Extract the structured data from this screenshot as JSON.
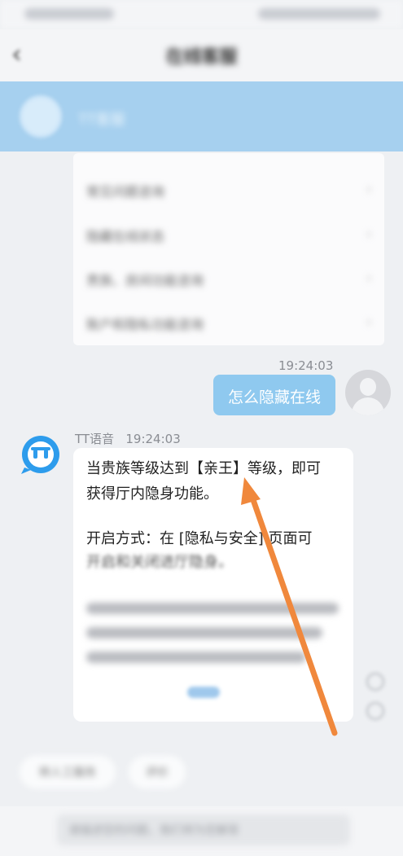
{
  "nav": {
    "title": "在线客服",
    "back": "‹"
  },
  "profile": {
    "name": "TT客服"
  },
  "faq": {
    "items": [
      {
        "label": "常见问题咨询"
      },
      {
        "label": "隐藏在线状态"
      },
      {
        "label": "贵族、房间功能咨询"
      },
      {
        "label": "账户和隐私功能咨询"
      }
    ]
  },
  "user_message": {
    "time": "19:24:03",
    "text": "怎么隐藏在线"
  },
  "bot_message": {
    "sender": "TT语音",
    "time": "19:24:03",
    "line1": "当贵族等级达到【亲王】等级，即可",
    "line2": "获得厅内隐身功能。",
    "line3": "开启方式：在 [隐私与安全] 页面可",
    "line4": "开启和关闭进厅隐身。",
    "more_link": "展开"
  },
  "quick_replies": [
    {
      "label": "转人工服务"
    },
    {
      "label": "评价"
    }
  ],
  "input": {
    "placeholder": "请描述您的问题，我们将为您解答"
  },
  "colors": {
    "accent_blue": "#8fc9ef",
    "profile_bar": "#a6d0ef",
    "annotation_arrow": "#f0883c",
    "bot_icon_blue": "#2d9cec"
  }
}
